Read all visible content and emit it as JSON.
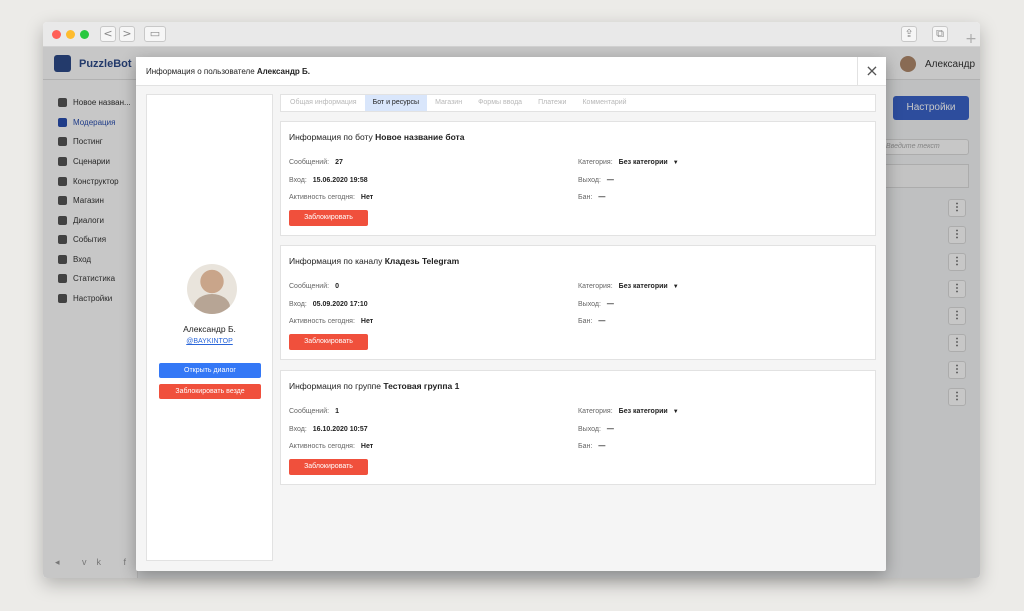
{
  "browser": {
    "back": "<",
    "forward": ">",
    "share": "⇪",
    "tabs": "⧉",
    "new_tab": "+"
  },
  "app": {
    "logo": "PuzzleBot",
    "user_name": "Александр",
    "sidebar": [
      {
        "label": "Новое назван...",
        "icon": "bot-icon"
      },
      {
        "label": "Модерация",
        "icon": "users-icon",
        "active": true
      },
      {
        "label": "Постинг",
        "icon": "send-icon"
      },
      {
        "label": "Сценарии",
        "icon": "scenario-icon"
      },
      {
        "label": "Конструктор",
        "icon": "grid-icon"
      },
      {
        "label": "Магазин",
        "icon": "shop-icon"
      },
      {
        "label": "Диалоги",
        "icon": "chat-icon"
      },
      {
        "label": "События",
        "icon": "star-icon"
      },
      {
        "label": "Вход",
        "icon": "login-icon"
      },
      {
        "label": "Статистика",
        "icon": "stats-icon"
      },
      {
        "label": "Настройки",
        "icon": "gear-icon"
      }
    ],
    "footer_icons": "◂ vk f",
    "settings_button": "Настройки",
    "search_placeholder": "Введите текст",
    "kebab": "⋮"
  },
  "modal": {
    "title_prefix": "Информация о пользователе",
    "title_name": "Александр Б.",
    "close": "×",
    "profile": {
      "name": "Александр Б.",
      "handle": "@BAYKINTOP",
      "open_dialog": "Открыть диалог",
      "block_everywhere": "Заблокировать везде"
    },
    "tabs": [
      {
        "label": "Общая информация",
        "active": false
      },
      {
        "label": "Бот и ресурсы",
        "active": true
      },
      {
        "label": "Магазин",
        "active": false
      },
      {
        "label": "Формы ввода",
        "active": false
      },
      {
        "label": "Платежи",
        "active": false
      },
      {
        "label": "Комментарий",
        "active": false
      }
    ],
    "cards": [
      {
        "title_prefix": "Информация по боту",
        "title_name": "Новое название бота",
        "messages_label": "Сообщений:",
        "messages": "27",
        "entry_label": "Вход:",
        "entry": "15.06.2020 19:58",
        "activity_label": "Активность сегодня:",
        "activity": "Нет",
        "category_label": "Категория:",
        "category": "Без категории",
        "exit_label": "Выход:",
        "exit": "—",
        "ban_label": "Бан:",
        "ban": "—",
        "block": "Заблокировать"
      },
      {
        "title_prefix": "Информация по каналу",
        "title_name": "Кладезь Telegram",
        "messages_label": "Сообщений:",
        "messages": "0",
        "entry_label": "Вход:",
        "entry": "05.09.2020 17:10",
        "activity_label": "Активность сегодня:",
        "activity": "Нет",
        "category_label": "Категория:",
        "category": "Без категории",
        "exit_label": "Выход:",
        "exit": "—",
        "ban_label": "Бан:",
        "ban": "—",
        "block": "Заблокировать"
      },
      {
        "title_prefix": "Информация по группе",
        "title_name": "Тестовая группа 1",
        "messages_label": "Сообщений:",
        "messages": "1",
        "entry_label": "Вход:",
        "entry": "16.10.2020 10:57",
        "activity_label": "Активность сегодня:",
        "activity": "Нет",
        "category_label": "Категория:",
        "category": "Без категории",
        "exit_label": "Выход:",
        "exit": "—",
        "ban_label": "Бан:",
        "ban": "—",
        "block": "Заблокировать"
      }
    ]
  },
  "colors": {
    "accent_blue": "#3478f6",
    "danger_red": "#f0503c",
    "active_tab": "#d9e6fb",
    "link": "#2a66d9"
  }
}
